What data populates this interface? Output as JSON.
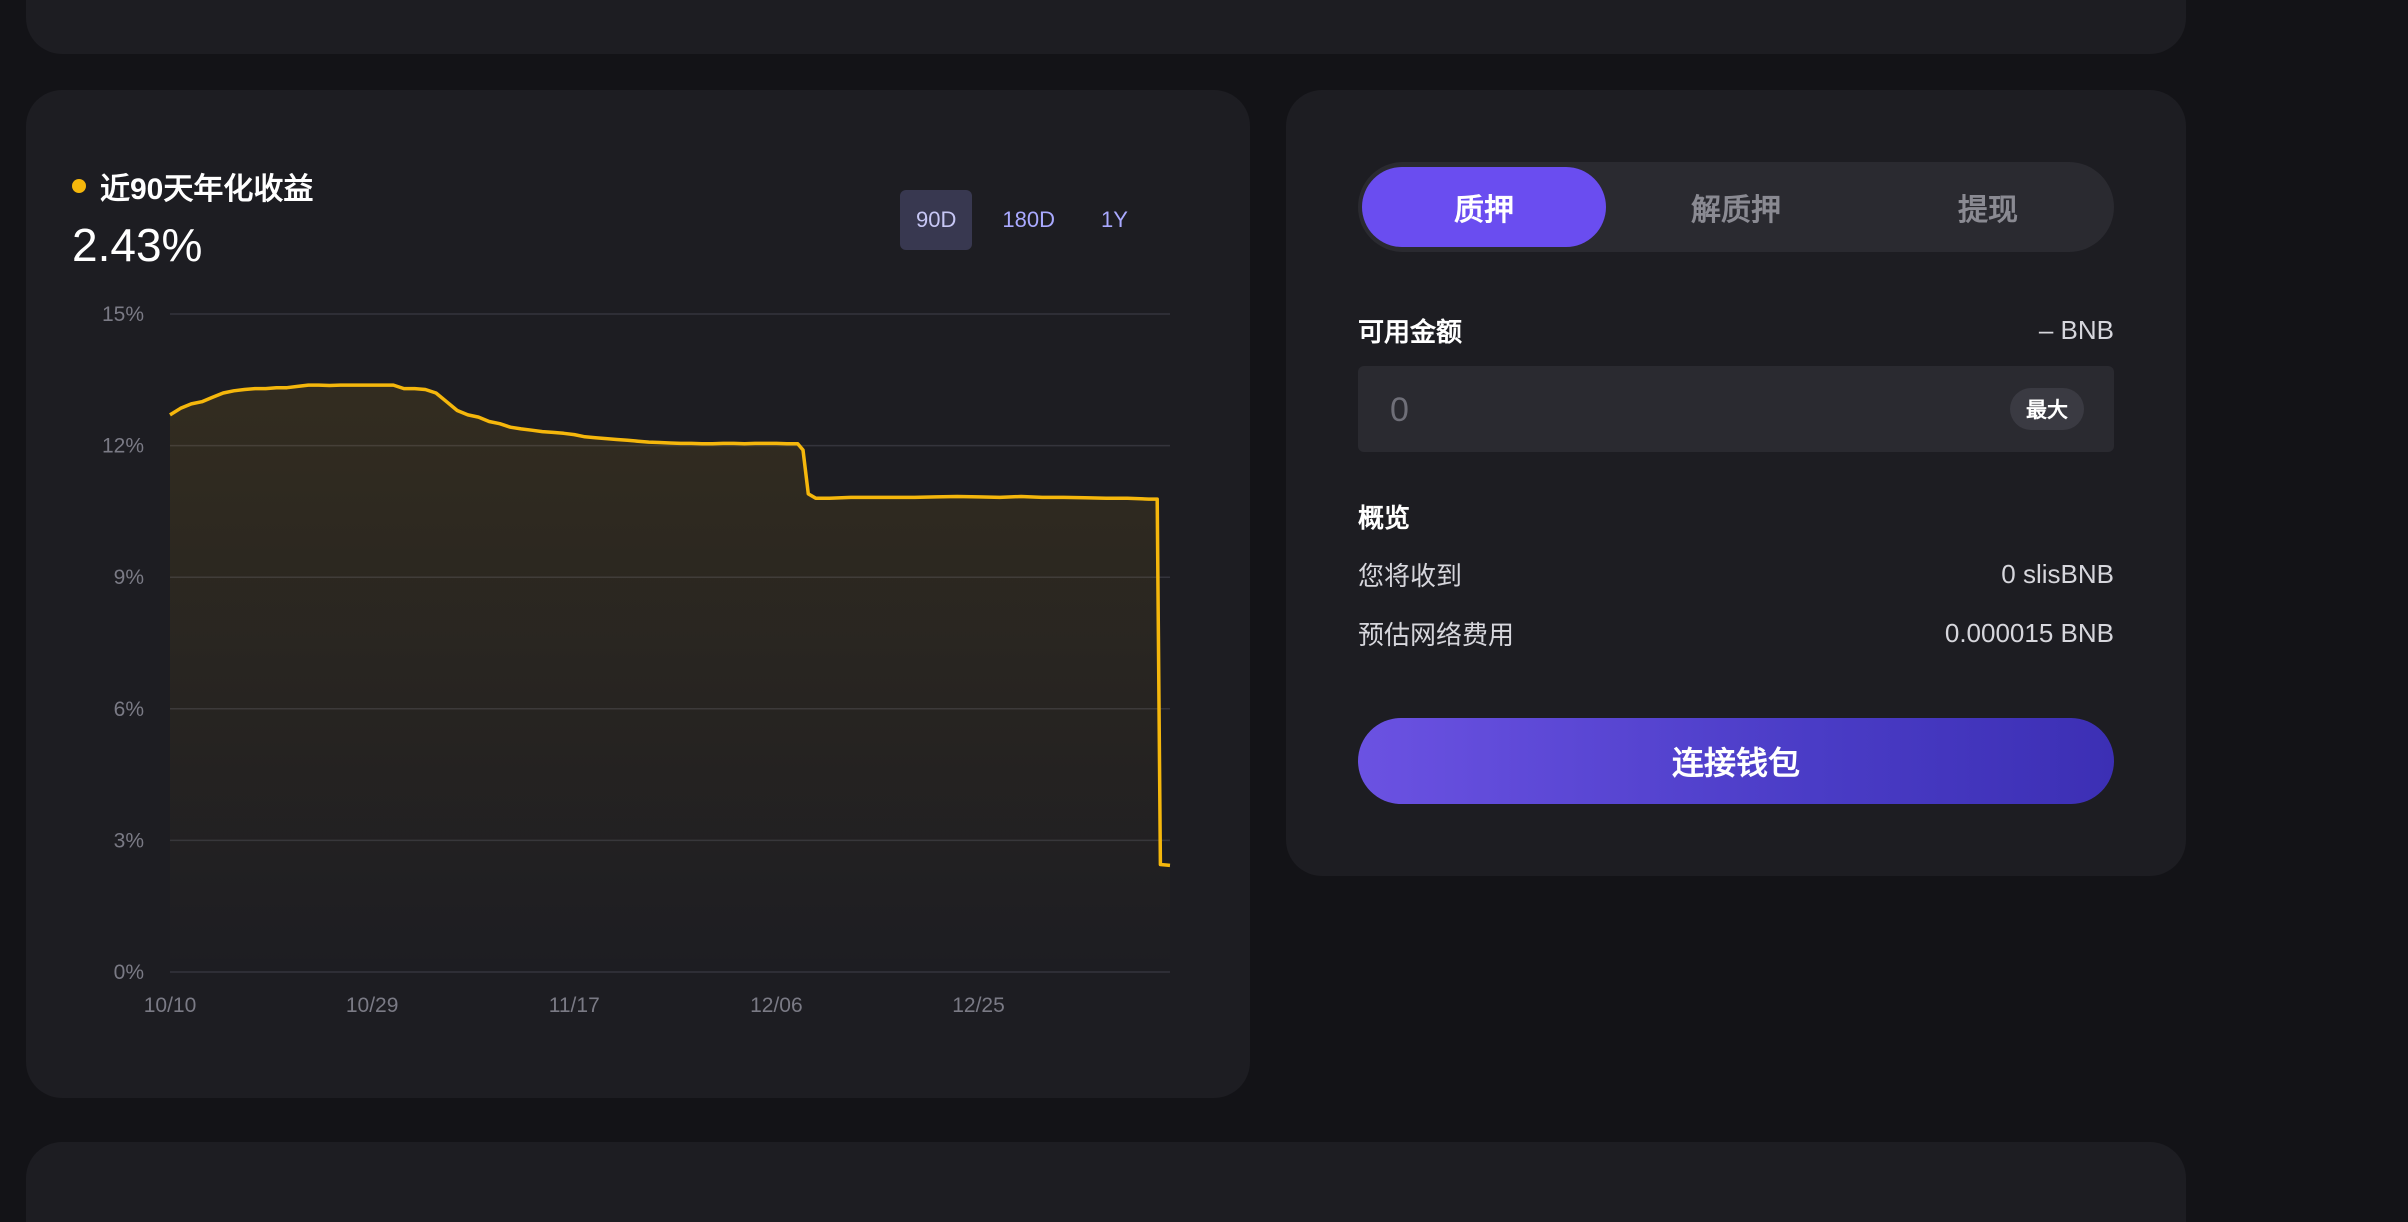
{
  "chart_panel": {
    "apy_label": "近90天年化收益",
    "apy_value": "2.43%",
    "ranges": [
      "90D",
      "180D",
      "1Y"
    ],
    "active_range": "90D",
    "accent_color": "#f5b70c"
  },
  "stake_panel": {
    "tabs": [
      "质押",
      "解质押",
      "提现"
    ],
    "active_tab": "质押",
    "available_label": "可用金额",
    "available_value": "– BNB",
    "amount_placeholder": "0",
    "max_label": "最大",
    "overview_title": "概览",
    "receive_label": "您将收到",
    "receive_value": "0 slisBNB",
    "fee_label": "预估网络费用",
    "fee_value": "0.000015 BNB",
    "connect_label": "连接钱包",
    "accent_color": "#6a4df0"
  },
  "chart_data": {
    "type": "area",
    "title": "",
    "xlabel": "",
    "ylabel": "",
    "x_ticks": [
      "10/10",
      "10/29",
      "11/17",
      "12/06",
      "12/25"
    ],
    "y_ticks": [
      "0%",
      "3%",
      "6%",
      "9%",
      "12%",
      "15%"
    ],
    "ylim": [
      0,
      15
    ],
    "xlim": [
      0,
      94
    ],
    "grid": true,
    "series": [
      {
        "color": "#f5b70c",
        "x": [
          0,
          1,
          2,
          3,
          4,
          5,
          6,
          7,
          8,
          9,
          10,
          11,
          12,
          13,
          14,
          15,
          16,
          17,
          18,
          19,
          20,
          21,
          22,
          23,
          24,
          25,
          26,
          27,
          28,
          29,
          30,
          31,
          32,
          33,
          34,
          35,
          36,
          37,
          38,
          39,
          40,
          41,
          42,
          43,
          44,
          45,
          46,
          47,
          48,
          49,
          50,
          51,
          52,
          53,
          54,
          55,
          56,
          57,
          58,
          59,
          59.5,
          60,
          60.7,
          61,
          62,
          64,
          66,
          68,
          70,
          72,
          74,
          76,
          78,
          80,
          82,
          84,
          86,
          88,
          89.5,
          90,
          92,
          92.8,
          93.1,
          94
        ],
        "values": [
          12.7,
          12.85,
          12.95,
          13.0,
          13.1,
          13.2,
          13.25,
          13.28,
          13.3,
          13.3,
          13.32,
          13.32,
          13.35,
          13.38,
          13.38,
          13.37,
          13.38,
          13.38,
          13.38,
          13.38,
          13.38,
          13.38,
          13.3,
          13.3,
          13.28,
          13.2,
          13.0,
          12.8,
          12.7,
          12.65,
          12.55,
          12.5,
          12.42,
          12.38,
          12.35,
          12.32,
          12.3,
          12.28,
          12.25,
          12.2,
          12.18,
          12.16,
          12.14,
          12.12,
          12.1,
          12.08,
          12.07,
          12.06,
          12.05,
          12.05,
          12.04,
          12.04,
          12.05,
          12.05,
          12.04,
          12.05,
          12.05,
          12.05,
          12.04,
          12.04,
          11.9,
          10.9,
          10.8,
          10.8,
          10.8,
          10.82,
          10.82,
          10.82,
          10.82,
          10.83,
          10.84,
          10.83,
          10.82,
          10.84,
          10.82,
          10.82,
          10.81,
          10.8,
          10.8,
          10.8,
          10.78,
          10.78,
          2.45,
          2.43
        ]
      }
    ]
  }
}
